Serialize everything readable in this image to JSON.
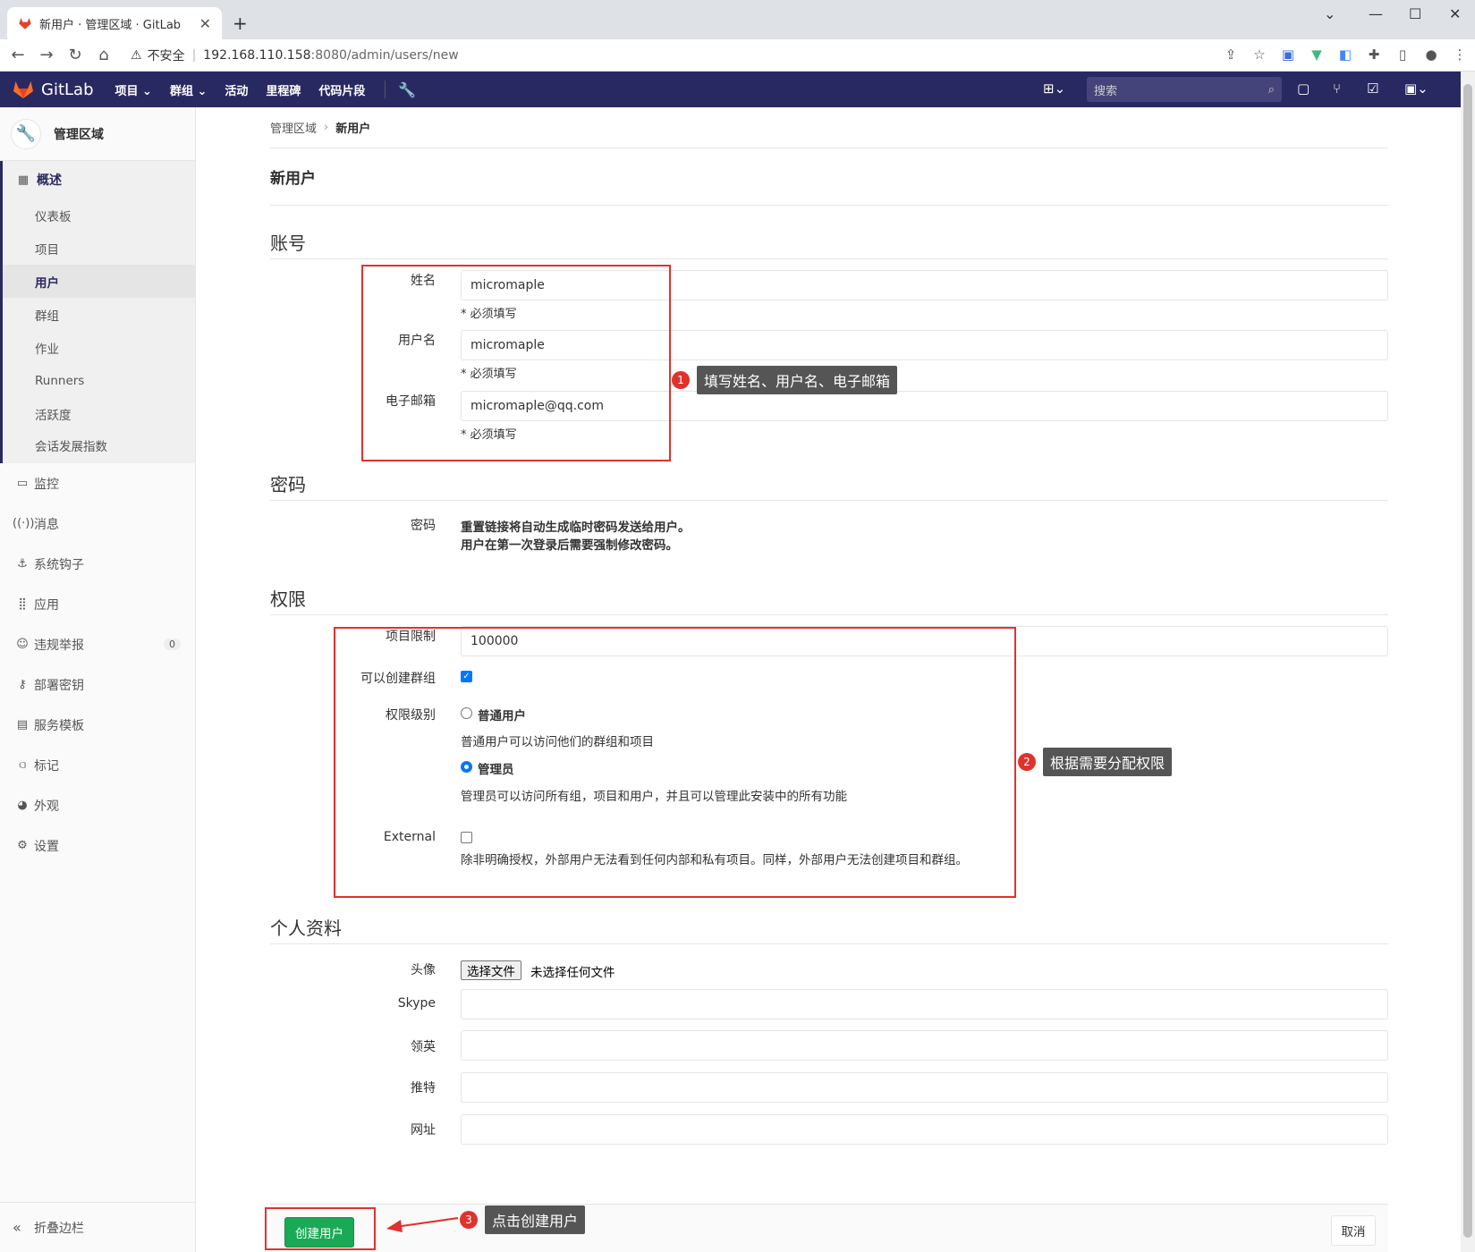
{
  "browser": {
    "tab_title": "新用户 · 管理区域 · GitLab",
    "url_warning": "不安全",
    "url_host": "192.168.110.158",
    "url_rest": ":8080/admin/users/new"
  },
  "topnav": {
    "brand": "GitLab",
    "items": [
      "项目",
      "群组",
      "活动",
      "里程碑",
      "代码片段"
    ],
    "search_placeholder": "搜索"
  },
  "sidebar": {
    "header": "管理区域",
    "overview": "概述",
    "sub_items": [
      "仪表板",
      "项目",
      "用户",
      "群组",
      "作业",
      "Runners",
      "活跃度",
      "会话发展指数"
    ],
    "active_sub": "用户",
    "items": [
      "监控",
      "消息",
      "系统钩子",
      "应用",
      "违规举报",
      "部署密钥",
      "服务模板",
      "标记",
      "外观",
      "设置"
    ],
    "abuse_badge": "0",
    "collapse": "折叠边栏"
  },
  "breadcrumb": {
    "root": "管理区域",
    "current": "新用户"
  },
  "page_title": "新用户",
  "account": {
    "section": "账号",
    "name_label": "姓名",
    "name_value": "micromaple",
    "username_label": "用户名",
    "username_value": "micromaple",
    "email_label": "电子邮箱",
    "email_value": "micromaple@qq.com",
    "required": "* 必须填写"
  },
  "password": {
    "section": "密码",
    "label": "密码",
    "line1": "重置链接将自动生成临时密码发送给用户。",
    "line2": "用户在第一次登录后需要强制修改密码。"
  },
  "access": {
    "section": "权限",
    "projects_limit_label": "项目限制",
    "projects_limit_value": "100000",
    "can_create_group_label": "可以创建群组",
    "level_label": "权限级别",
    "regular_label": "普通用户",
    "regular_desc": "普通用户可以访问他们的群组和项目",
    "admin_label": "管理员",
    "admin_desc": "管理员可以访问所有组，项目和用户，并且可以管理此安装中的所有功能",
    "external_label": "External",
    "external_desc": "除非明确授权，外部用户无法看到任何内部和私有项目。同样，外部用户无法创建项目和群组。"
  },
  "profile": {
    "section": "个人资料",
    "avatar_label": "头像",
    "file_button": "选择文件",
    "file_none": "未选择任何文件",
    "skype_label": "Skype",
    "linkedin_label": "领英",
    "twitter_label": "推特",
    "website_label": "网址"
  },
  "actions": {
    "create": "创建用户",
    "cancel": "取消"
  },
  "annotations": {
    "c1_num": "1",
    "c1_text": "填写姓名、用户名、电子邮箱",
    "c2_num": "2",
    "c2_text": "根据需要分配权限",
    "c3_num": "3",
    "c3_text": "点击创建用户"
  },
  "colors": {
    "nav": "#292961",
    "create": "#1aaa55",
    "annotation": "#e0322d"
  }
}
